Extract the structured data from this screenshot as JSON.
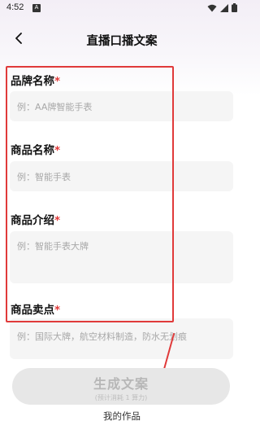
{
  "status_bar": {
    "time": "4:52",
    "notif_letter": "A"
  },
  "header": {
    "title": "直播口播文案"
  },
  "form": {
    "fields": [
      {
        "label": "品牌名称",
        "required_mark": "*",
        "placeholder": "例：AA牌智能手表"
      },
      {
        "label": "商品名称",
        "required_mark": "*",
        "placeholder": "例：智能手表"
      },
      {
        "label": "商品介绍",
        "required_mark": "*",
        "placeholder": "例：智能手表大牌"
      },
      {
        "label": "商品卖点",
        "required_mark": "*",
        "placeholder": "例：国际大牌，航空材料制造，防水无划痕"
      }
    ]
  },
  "generate_button": {
    "label": "生成文案",
    "sublabel": "(预计消耗 1 算力)"
  },
  "my_works_link": "我的作品",
  "colors": {
    "annotation_red": "#e03a3a",
    "required_red": "#e23b3b",
    "button_disabled_bg": "#e7e7e7"
  },
  "icons": [
    "wifi-icon",
    "cellular-icon",
    "battery-icon",
    "back-arrow-icon"
  ]
}
